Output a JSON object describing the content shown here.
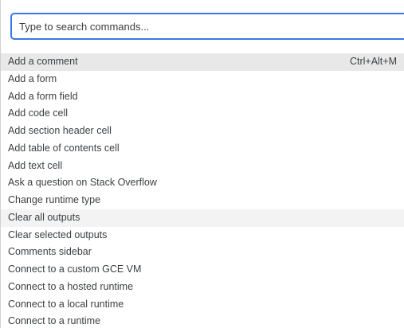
{
  "search": {
    "placeholder": "Type to search commands...",
    "value": ""
  },
  "commands": [
    {
      "label": "Add a comment",
      "shortcut": "Ctrl+Alt+M",
      "state": "selected"
    },
    {
      "label": "Add a form",
      "shortcut": "",
      "state": ""
    },
    {
      "label": "Add a form field",
      "shortcut": "",
      "state": ""
    },
    {
      "label": "Add code cell",
      "shortcut": "",
      "state": ""
    },
    {
      "label": "Add section header cell",
      "shortcut": "",
      "state": ""
    },
    {
      "label": "Add table of contents cell",
      "shortcut": "",
      "state": ""
    },
    {
      "label": "Add text cell",
      "shortcut": "",
      "state": ""
    },
    {
      "label": "Ask a question on Stack Overflow",
      "shortcut": "",
      "state": ""
    },
    {
      "label": "Change runtime type",
      "shortcut": "",
      "state": ""
    },
    {
      "label": "Clear all outputs",
      "shortcut": "",
      "state": "hovered"
    },
    {
      "label": "Clear selected outputs",
      "shortcut": "",
      "state": ""
    },
    {
      "label": "Comments sidebar",
      "shortcut": "",
      "state": ""
    },
    {
      "label": "Connect to a custom GCE VM",
      "shortcut": "",
      "state": ""
    },
    {
      "label": "Connect to a hosted runtime",
      "shortcut": "",
      "state": ""
    },
    {
      "label": "Connect to a local runtime",
      "shortcut": "",
      "state": ""
    },
    {
      "label": "Connect to a runtime",
      "shortcut": "",
      "state": ""
    }
  ]
}
